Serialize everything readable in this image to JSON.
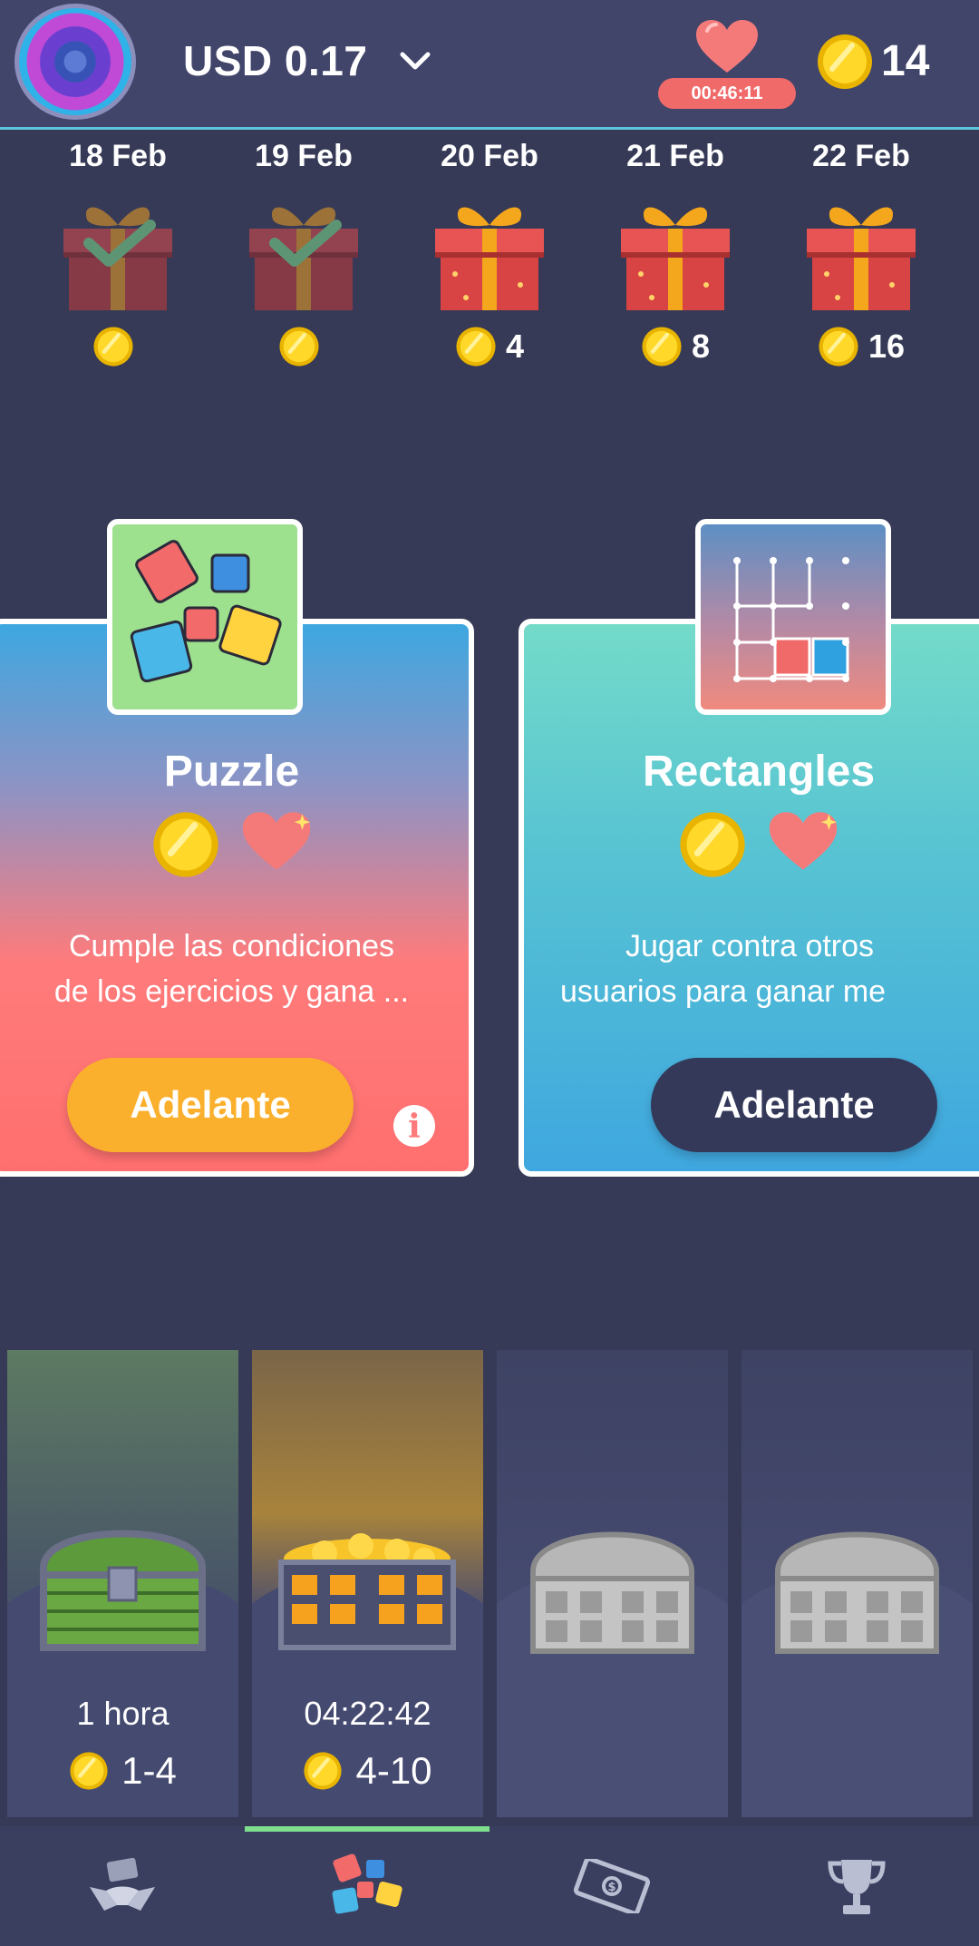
{
  "header": {
    "balance": "USD 0.17",
    "timer": "00:46:11",
    "coins": "14"
  },
  "daily": [
    {
      "date": "18 Feb",
      "claimed": true,
      "reward": ""
    },
    {
      "date": "19 Feb",
      "claimed": true,
      "reward": ""
    },
    {
      "date": "20 Feb",
      "claimed": false,
      "reward": "4"
    },
    {
      "date": "21 Feb",
      "claimed": false,
      "reward": "8"
    },
    {
      "date": "22 Feb",
      "claimed": false,
      "reward": "16"
    }
  ],
  "games": [
    {
      "title": "Puzzle",
      "desc_line1": "Cumple las condiciones",
      "desc_line2": "de los ejercicios y gana ...",
      "button": "Adelante"
    },
    {
      "title": "Rectangles",
      "desc_line1": "Jugar contra otros",
      "desc_line2": "usuarios para ganar me",
      "button": "Adelante"
    }
  ],
  "chests": [
    {
      "time": "1 hora",
      "range": "1-4",
      "state": "green"
    },
    {
      "time": "04:22:42",
      "range": "4-10",
      "state": "gold"
    },
    {
      "time": "",
      "range": "",
      "state": "locked"
    },
    {
      "time": "",
      "range": "",
      "state": "locked"
    }
  ],
  "colors": {
    "background": "#363a56",
    "header": "#41456a",
    "accent_yellow": "#fbb02d",
    "heart": "#f06a6a",
    "active_tab": "#7ee08e"
  },
  "nav": [
    "money-hands-icon",
    "puzzle-icon",
    "banknote-icon",
    "trophy-icon"
  ]
}
